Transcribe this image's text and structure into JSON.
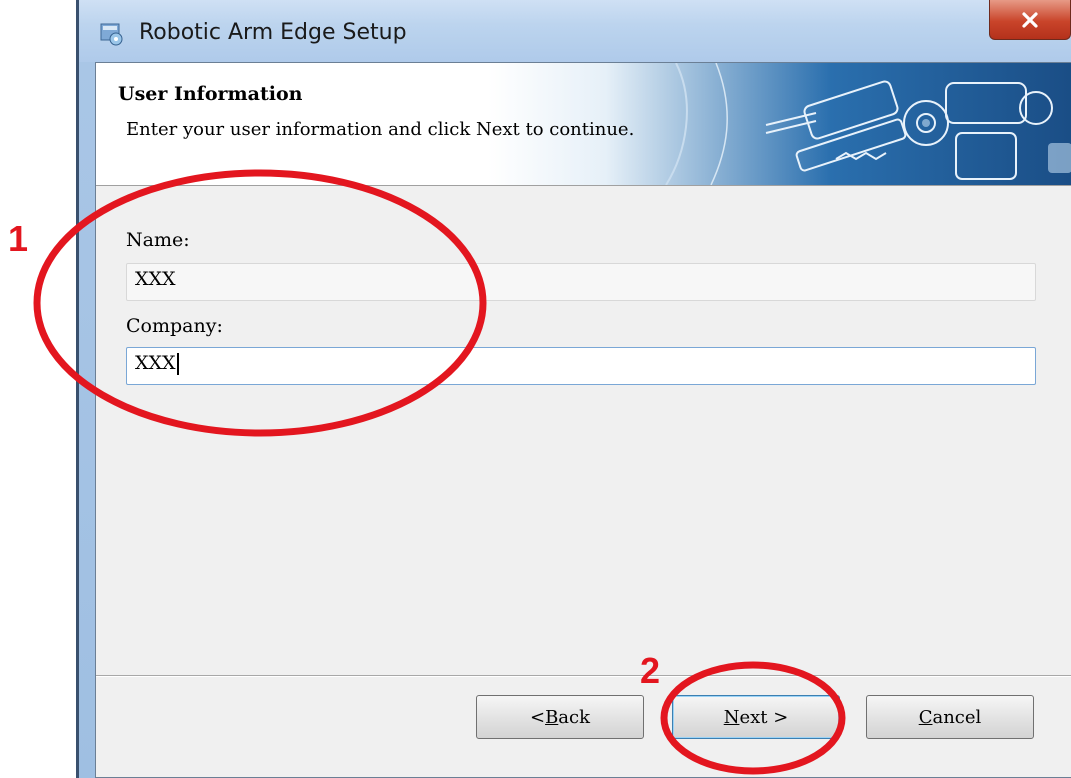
{
  "window": {
    "title": "Robotic Arm Edge Setup",
    "close_glyph": "x"
  },
  "header": {
    "title": "User Information",
    "subtitle": "Enter your user information and click Next to continue."
  },
  "form": {
    "name_label": "Name:",
    "name_value": "XXX",
    "company_label": "Company:",
    "company_value": "XXX"
  },
  "buttons": {
    "back_prefix": "< ",
    "back_mnemonic": "B",
    "back_rest": "ack",
    "next_mnemonic": "N",
    "next_rest": "ext >",
    "cancel_mnemonic": "C",
    "cancel_rest": "ancel"
  },
  "annotations": {
    "step1": "1",
    "step2": "2",
    "color": "#e3161f"
  },
  "icons": {
    "app": "setup-app-icon",
    "close": "close-icon",
    "banner": "robotic-arm-banner"
  }
}
